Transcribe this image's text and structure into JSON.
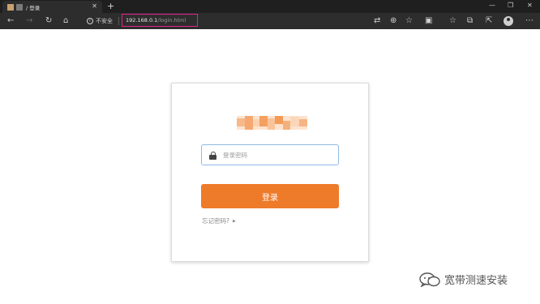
{
  "browser": {
    "tab_title": "/ 登录",
    "url_host": "192.168.0.1",
    "url_path": "/login.html",
    "security_label": "不安全"
  },
  "login": {
    "password_placeholder": "登录密码",
    "password_value": "",
    "submit_label": "登录",
    "forgot_label": "忘记密码?"
  },
  "watermark": {
    "text": "宽带测速安装"
  },
  "colors": {
    "accent": "#ee7b2a",
    "url_highlight": "#e0248b",
    "input_border": "#8fbbe6"
  }
}
